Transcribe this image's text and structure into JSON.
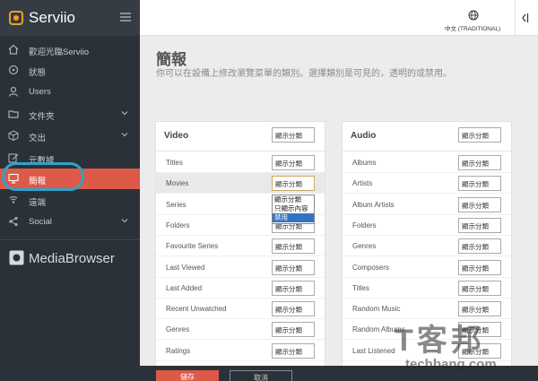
{
  "app": {
    "title": "Serviio"
  },
  "sidebar": {
    "items": [
      {
        "label": "歡迎光臨Serviio",
        "icon": "home-icon"
      },
      {
        "label": "狀態",
        "icon": "gauge-icon"
      },
      {
        "label": "Users",
        "icon": "user-icon"
      },
      {
        "label": "文件夾",
        "icon": "folder-icon"
      },
      {
        "label": "交出",
        "icon": "box-icon"
      },
      {
        "label": "元數據",
        "icon": "edit-icon"
      },
      {
        "label": "簡報",
        "icon": "presentation-icon"
      },
      {
        "label": "遠端",
        "icon": "remote-icon"
      },
      {
        "label": "Social",
        "icon": "share-icon"
      }
    ],
    "active_index": 6,
    "footer_brand": "MediaBrowser"
  },
  "topbar": {
    "language": "中文 (TRADITIONAL)"
  },
  "page": {
    "title": "簡報",
    "subtitle": "你可以在設備上修改瀏覽菜單的類別。選擇類別是可見的，透明的或禁用。"
  },
  "video_panel": {
    "title": "Video",
    "header_select": "顯示分類",
    "rows": [
      {
        "label": "Titles",
        "value": "顯示分類"
      },
      {
        "label": "Movies",
        "value": "顯示分類"
      },
      {
        "label": "Series",
        "value": "顯示分類"
      },
      {
        "label": "Folders",
        "value": "顯示分類"
      },
      {
        "label": "Favourite Series",
        "value": "顯示分類"
      },
      {
        "label": "Last Viewed",
        "value": "顯示分類"
      },
      {
        "label": "Last Added",
        "value": "顯示分類"
      },
      {
        "label": "Recent Unwatched",
        "value": "顯示分類"
      },
      {
        "label": "Genres",
        "value": "顯示分類"
      },
      {
        "label": "Ratings",
        "value": "顯示分類"
      }
    ]
  },
  "audio_panel": {
    "title": "Audio",
    "header_select": "顯示分類",
    "rows": [
      {
        "label": "Albums",
        "value": "顯示分類"
      },
      {
        "label": "Artists",
        "value": "顯示分類"
      },
      {
        "label": "Album Artists",
        "value": "顯示分類"
      },
      {
        "label": "Folders",
        "value": "顯示分類"
      },
      {
        "label": "Genres",
        "value": "顯示分類"
      },
      {
        "label": "Composers",
        "value": "顯示分類"
      },
      {
        "label": "Titles",
        "value": "顯示分類"
      },
      {
        "label": "Random Music",
        "value": "顯示分類"
      },
      {
        "label": "Random Albums",
        "value": "顯示分類"
      },
      {
        "label": "Last Listened",
        "value": "顯示分類"
      }
    ]
  },
  "dropdown": {
    "options": [
      "顯示分類",
      "只顯示內容",
      "禁用"
    ],
    "highlighted_index": 2
  },
  "footer": {
    "save_label": "儲存",
    "cancel_label": "取消"
  },
  "watermark": {
    "logo": "T客邦",
    "text": "techbang.com"
  },
  "colors": {
    "accent": "#dc5a47",
    "sidebar": "#2b3138",
    "highlight_ring": "#2fa3c9",
    "option_selected": "#3373c6"
  }
}
